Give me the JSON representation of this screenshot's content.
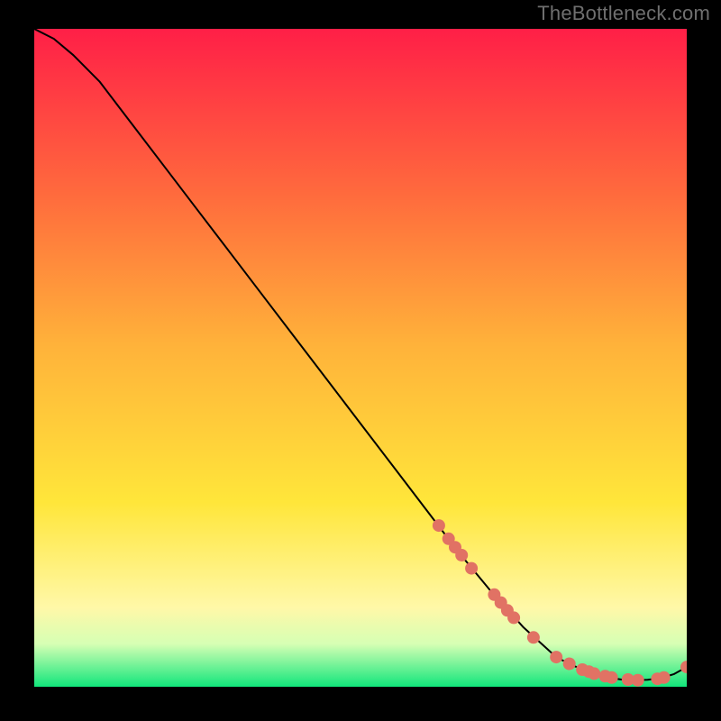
{
  "attribution": "TheBottleneck.com",
  "colors": {
    "grad_top": "#ff1f47",
    "grad_mid1": "#ff6a3d",
    "grad_mid2": "#ffb23a",
    "grad_mid3": "#ffe63a",
    "grad_low1": "#fff8a8",
    "grad_low2": "#d6ffb4",
    "grad_bottom": "#11e67b",
    "marker": "#e17264",
    "curve": "#000000",
    "bg": "#000000"
  },
  "chart_data": {
    "type": "line",
    "title": "",
    "xlabel": "",
    "ylabel": "",
    "xlim": [
      0,
      100
    ],
    "ylim": [
      0,
      100
    ],
    "curve": {
      "x": [
        0,
        3,
        6,
        10,
        15,
        20,
        25,
        30,
        35,
        40,
        45,
        50,
        55,
        60,
        65,
        70,
        75,
        80,
        82,
        84,
        86,
        88,
        90,
        92,
        94,
        96,
        98,
        100
      ],
      "y": [
        100,
        98.5,
        96,
        92,
        85.5,
        79,
        72.5,
        66,
        59.5,
        53,
        46.5,
        40,
        33.5,
        27,
        20.5,
        14.5,
        9,
        4.5,
        3.5,
        2.6,
        1.9,
        1.4,
        1.1,
        1.0,
        1.05,
        1.3,
        1.9,
        3.0
      ]
    },
    "markers": [
      {
        "x": 62.0,
        "y": 24.5
      },
      {
        "x": 63.5,
        "y": 22.5
      },
      {
        "x": 64.5,
        "y": 21.2
      },
      {
        "x": 65.5,
        "y": 20.0
      },
      {
        "x": 67.0,
        "y": 18.0
      },
      {
        "x": 70.5,
        "y": 14.0
      },
      {
        "x": 71.5,
        "y": 12.8
      },
      {
        "x": 72.5,
        "y": 11.6
      },
      {
        "x": 73.5,
        "y": 10.5
      },
      {
        "x": 76.5,
        "y": 7.5
      },
      {
        "x": 80.0,
        "y": 4.5
      },
      {
        "x": 82.0,
        "y": 3.5
      },
      {
        "x": 84.0,
        "y": 2.6
      },
      {
        "x": 85.0,
        "y": 2.3
      },
      {
        "x": 85.8,
        "y": 2.0
      },
      {
        "x": 87.5,
        "y": 1.6
      },
      {
        "x": 88.5,
        "y": 1.4
      },
      {
        "x": 91.0,
        "y": 1.1
      },
      {
        "x": 92.5,
        "y": 1.0
      },
      {
        "x": 95.5,
        "y": 1.2
      },
      {
        "x": 96.5,
        "y": 1.4
      },
      {
        "x": 100.0,
        "y": 3.0
      }
    ]
  }
}
